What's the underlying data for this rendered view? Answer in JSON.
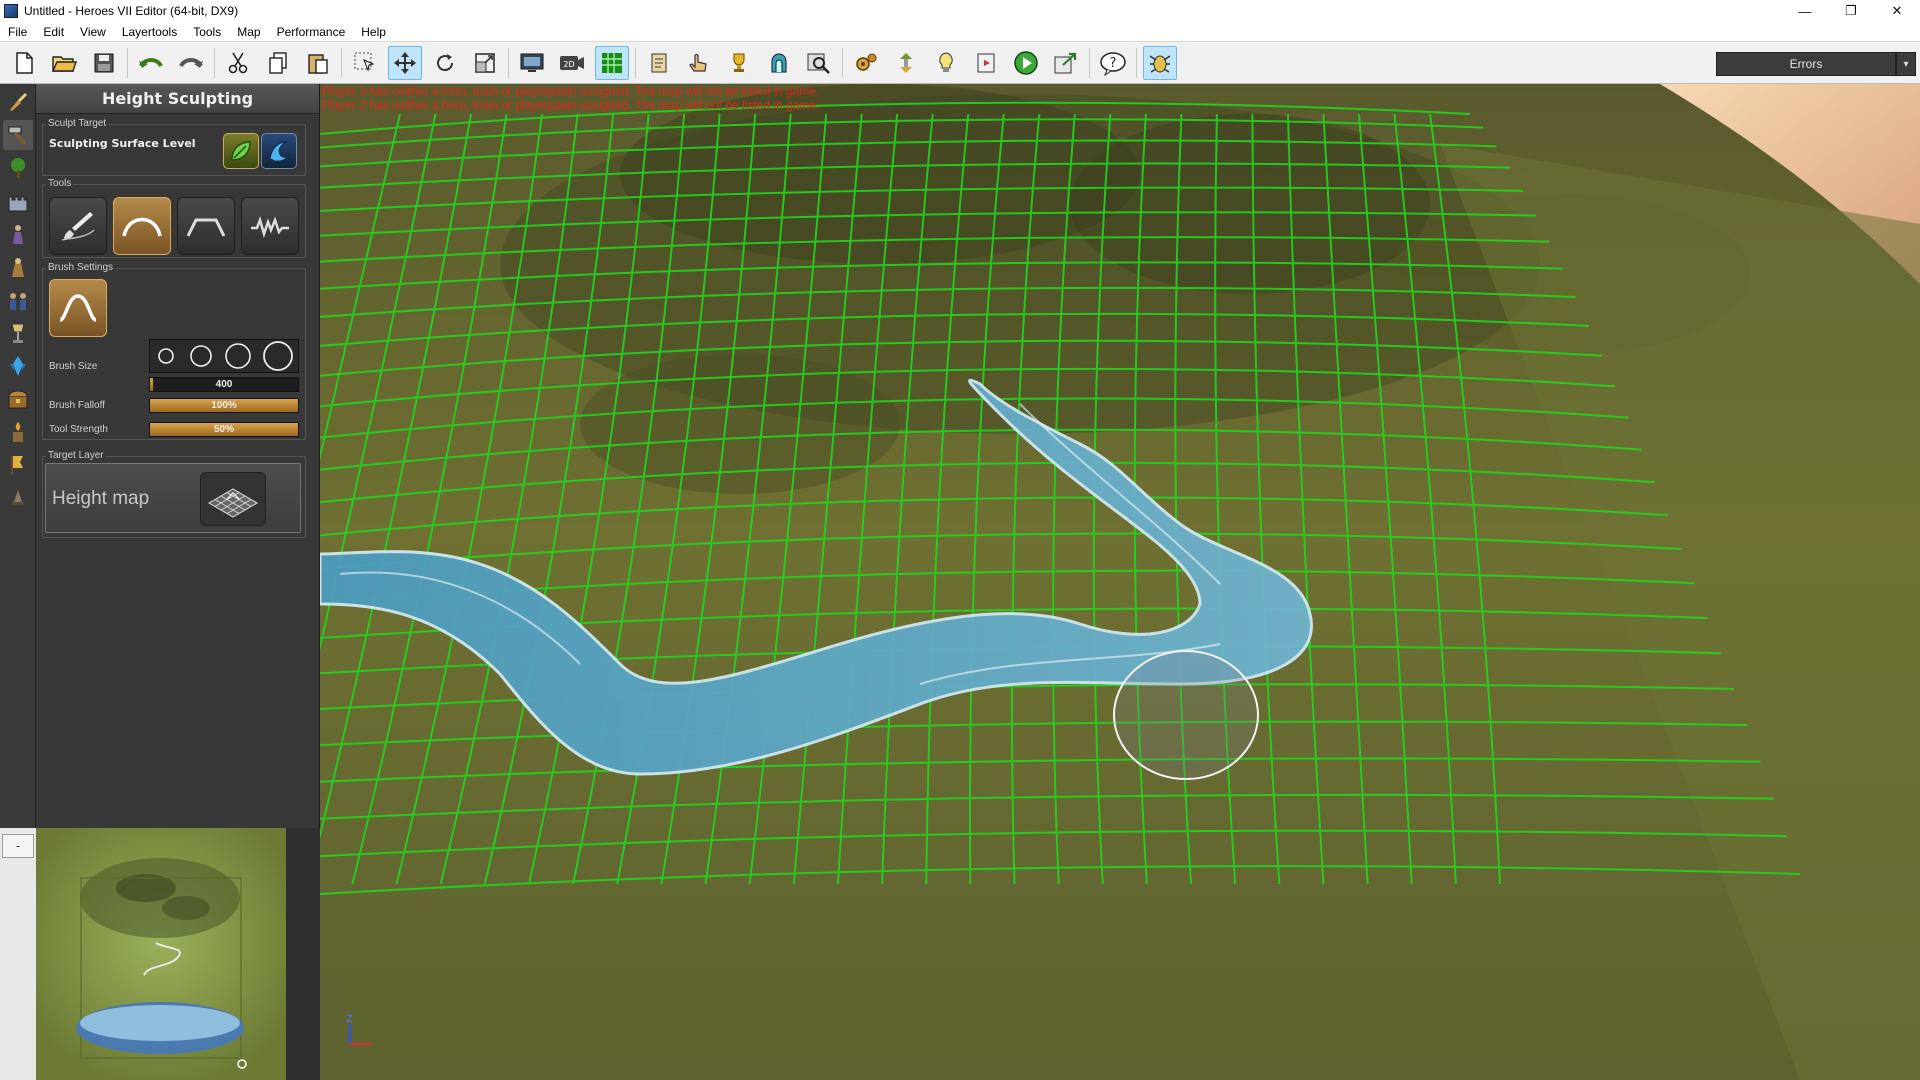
{
  "window": {
    "title": "Untitled - Heroes VII Editor (64-bit, DX9)",
    "minimize": "—",
    "restore": "❐",
    "close": "✕"
  },
  "menu": [
    "File",
    "Edit",
    "View",
    "Layertools",
    "Tools",
    "Map",
    "Performance",
    "Help"
  ],
  "toolbar": {
    "errors_label": "Errors",
    "errors_dropdown": "▾"
  },
  "panel": {
    "title": "Height Sculpting",
    "sculpt_target": {
      "group_label": "Sculpt Target",
      "label": "Sculpting Surface Level"
    },
    "tools": {
      "group_label": "Tools"
    },
    "brush": {
      "group_label": "Brush Settings",
      "size_label": "Brush Size",
      "size_value": "400",
      "size_fraction": 0.02,
      "falloff_label": "Brush Falloff",
      "falloff_value": "100%",
      "falloff_fraction": 1.0,
      "strength_label": "Tool Strength",
      "strength_value": "50%",
      "strength_fraction": 1.0
    },
    "target_layer": {
      "group_label": "Target Layer",
      "name": "Height map"
    }
  },
  "minimap": {
    "collapse_label": "-"
  },
  "viewport": {
    "warnings": [
      "Player 3 has neither a hero, town or playerpawn assigned. The map will not be listed in game.",
      "Player 2 has neither a hero, town or playerpawn assigned. The map will not be listed in game."
    ]
  },
  "colors": {
    "grid": "#23d41e",
    "water": "#5fa7c2",
    "terrain": "#6c6a32",
    "accent": "#c8923a",
    "warning": "#e0261a"
  }
}
